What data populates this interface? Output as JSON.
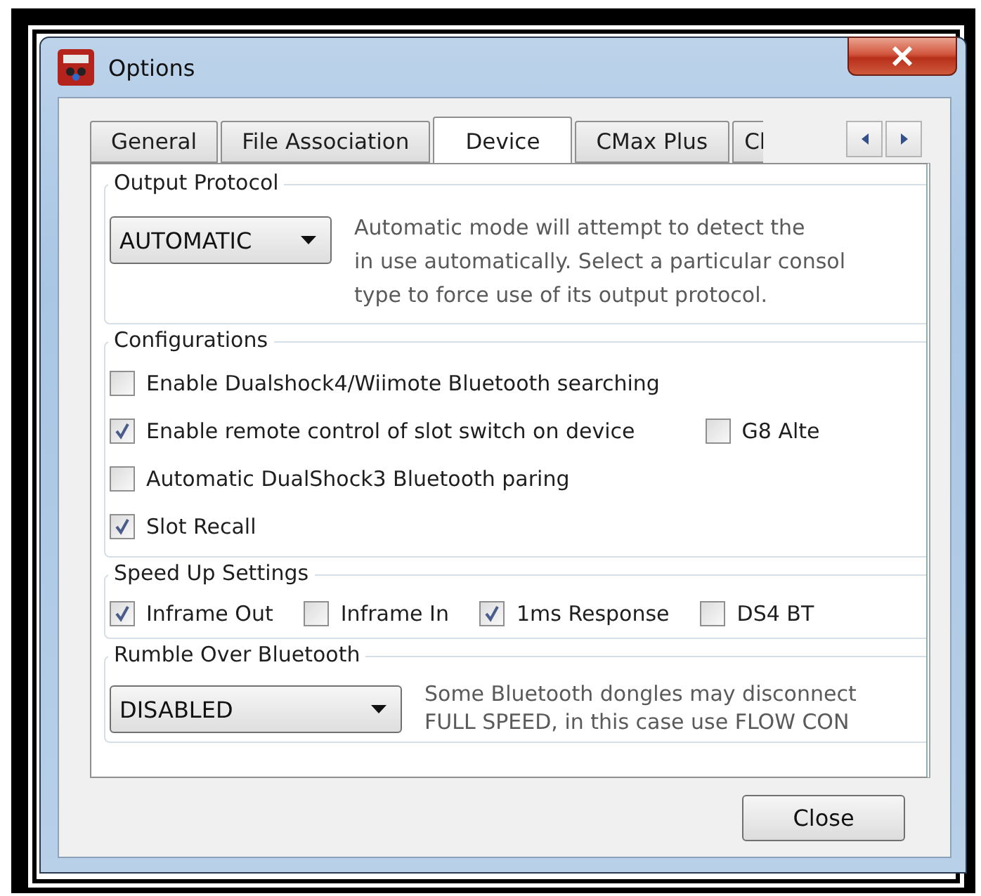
{
  "window": {
    "title": "Options"
  },
  "tabs": [
    {
      "label": "General",
      "selected": false
    },
    {
      "label": "File Association",
      "selected": false
    },
    {
      "label": "Device",
      "selected": true
    },
    {
      "label": "CMax Plus",
      "selected": false
    },
    {
      "label": "Cl",
      "selected": false
    }
  ],
  "output_protocol": {
    "title": "Output Protocol",
    "dropdown": "AUTOMATIC",
    "description": [
      "Automatic mode will attempt to detect the",
      "in use automatically. Select a particular consol",
      "type to force use of its output protocol."
    ]
  },
  "configurations": {
    "title": "Configurations",
    "rows": [
      {
        "items": [
          {
            "label": "Enable Dualshock4/Wiimote Bluetooth searching",
            "checked": false
          }
        ]
      },
      {
        "items": [
          {
            "label": "Enable remote control of slot switch on device",
            "checked": true
          },
          {
            "label": "G8 Alte",
            "checked": false
          }
        ]
      },
      {
        "items": [
          {
            "label": "Automatic DualShock3 Bluetooth paring",
            "checked": false
          }
        ]
      },
      {
        "items": [
          {
            "label": "Slot Recall",
            "checked": true
          }
        ]
      }
    ]
  },
  "speed_up_settings": {
    "title": "Speed Up Settings",
    "items": [
      {
        "label": "Inframe Out",
        "checked": true
      },
      {
        "label": "Inframe In",
        "checked": false
      },
      {
        "label": "1ms Response",
        "checked": true
      },
      {
        "label": "DS4 BT",
        "checked": false
      }
    ]
  },
  "rumble_over_bluetooth": {
    "title": "Rumble Over Bluetooth",
    "dropdown": "DISABLED",
    "description": [
      "Some Bluetooth dongles may disconnect",
      "FULL SPEED, in this case use FLOW CON"
    ]
  },
  "close_button": "Close"
}
